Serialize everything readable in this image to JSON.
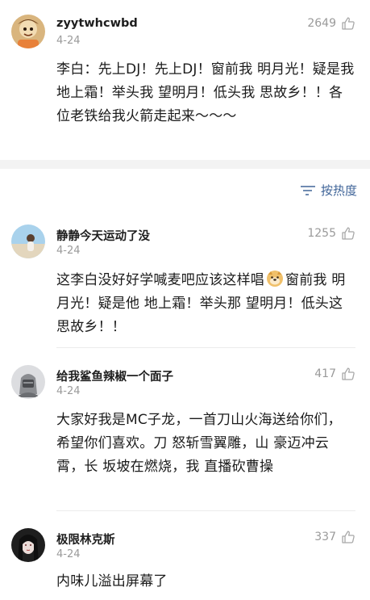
{
  "comments": [
    {
      "username": "zyytwhcwbd",
      "date": "4-24",
      "likes": "2649",
      "text": "李白：先上DJ！先上DJ！窗前我 明月光！疑是我 地上霜！举头我 望明月！低头我 思故乡！！各位老铁给我火箭走起来～～～",
      "avatar_colors": [
        "#e9c68f",
        "#7a4d2a"
      ]
    },
    {
      "username": "静静今天运动了没",
      "date": "4-24",
      "likes": "1255",
      "text_before": "这李白没好好学喊麦吧应该这样唱",
      "emoji": "doge-emoji",
      "text_after": "窗前我 明月光！疑是他 地上霜！举头那 望明月！低头这 思故乡！！",
      "avatar_colors": [
        "#9cc7e6",
        "#d8c5a6"
      ]
    },
    {
      "username": "给我鲨鱼辣椒一个面子",
      "date": "4-24",
      "likes": "417",
      "text": "大家好我是MC子龙，一首刀山火海送给你们，希望你们喜欢。刀  怒斩雪翼雕，山  豪迈冲云霄，长  坂坡在燃烧，我  直播砍曹操",
      "avatar_colors": [
        "#8d8f93",
        "#3e3f42"
      ]
    },
    {
      "username": "极限林克斯",
      "date": "4-24",
      "likes": "337",
      "text": "内味儿溢出屏幕了",
      "avatar_colors": [
        "#2b2b2b",
        "#e7d7d4"
      ]
    }
  ],
  "sort": {
    "label": "按热度",
    "icon": "sort-lines-icon"
  },
  "colors": {
    "accent": "#406599",
    "meta": "#9a9a9a",
    "separator": "#f3f3f3"
  }
}
